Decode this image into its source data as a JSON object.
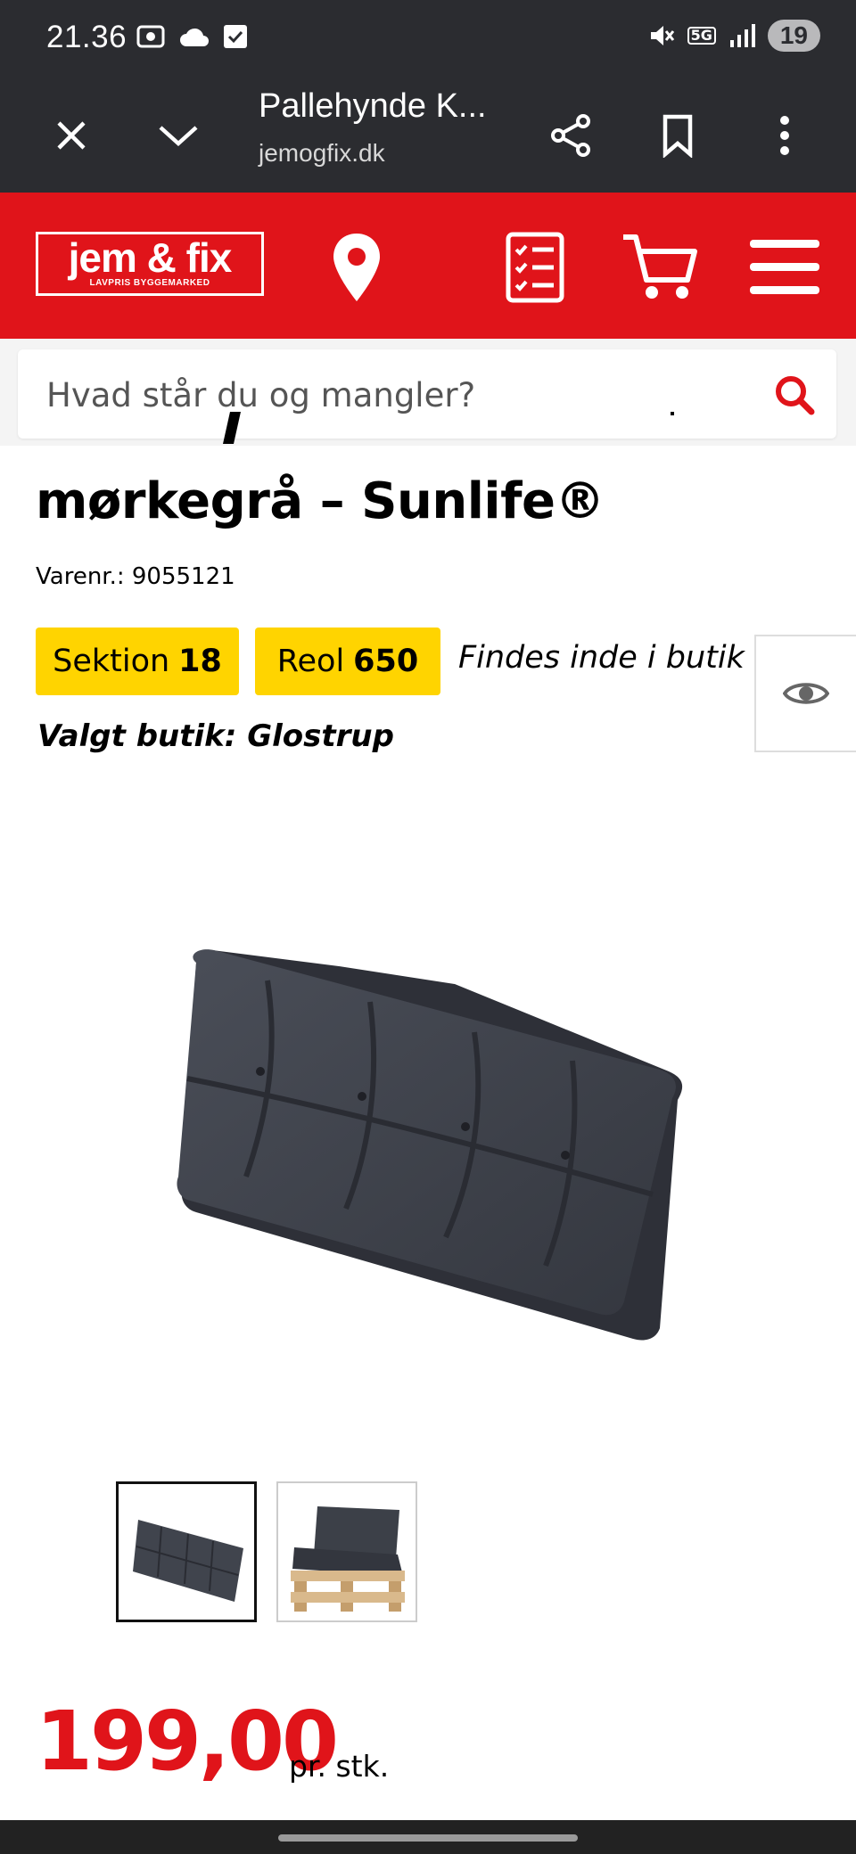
{
  "status": {
    "time": "21.36",
    "network": "5G",
    "battery": "19",
    "icons": [
      "screenshot-icon",
      "cloud-icon",
      "checkbox-icon",
      "mute-icon",
      "signal-icon"
    ]
  },
  "browser": {
    "page_title": "Pallehynde K...",
    "url": "jemogfix.dk"
  },
  "header": {
    "logo_main": "jem & fix",
    "logo_sub": "LAVPRIS BYGGEMARKED",
    "brand_color": "#e0141a"
  },
  "search": {
    "placeholder": "Hvad står du og mangler?"
  },
  "product": {
    "title_line2": "mørkegrå – Sunlife®",
    "sku": "Varenr.: 9055121",
    "section_label": "Sektion",
    "section_value": "18",
    "shelf_label": "Reol",
    "shelf_value": "650",
    "availability": "Findes inde i butik",
    "selected_store": "Valgt butik: Glostrup",
    "price": "199,00",
    "price_unit": "pr. stk.",
    "badge_color": "#ffd400"
  }
}
